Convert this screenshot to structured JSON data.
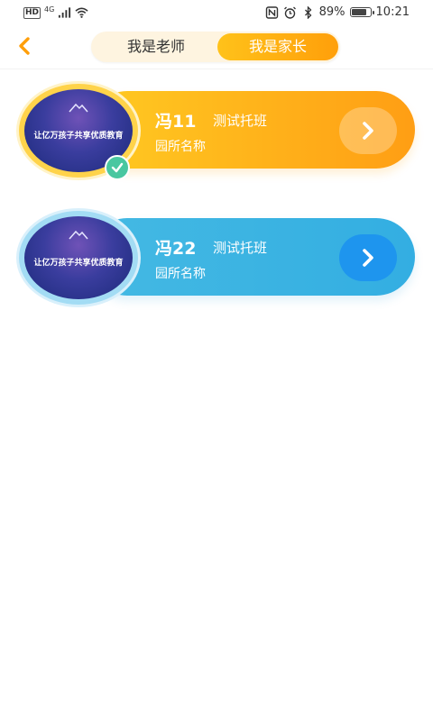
{
  "status_bar": {
    "network_badge": "HD",
    "network_type": "4G",
    "battery_percent": "89%",
    "battery_level": 0.89,
    "time": "10:21"
  },
  "header": {
    "back_icon": "chevron-left-icon",
    "tabs": [
      {
        "label": "我是老师",
        "selected": false
      },
      {
        "label": "我是家长",
        "selected": true
      }
    ],
    "accent": "#ff9f0a"
  },
  "cards": [
    {
      "name": "冯11",
      "class_name": "测试托班",
      "school": "园所名称",
      "avatar_slogan": "让亿万孩子共享优质教育",
      "selected": true,
      "theme_color": "#ffb01a",
      "arrow_icon": "chevron-right-icon"
    },
    {
      "name": "冯22",
      "class_name": "测试托班",
      "school": "园所名称",
      "avatar_slogan": "让亿万孩子共享优质教育",
      "selected": false,
      "theme_color": "#3fb4e2",
      "arrow_icon": "chevron-right-icon"
    }
  ]
}
